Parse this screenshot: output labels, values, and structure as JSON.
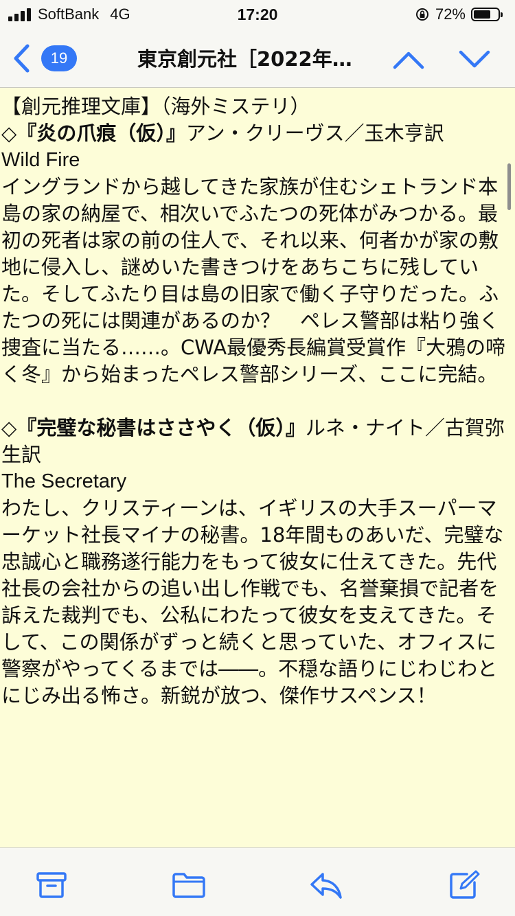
{
  "status_bar": {
    "carrier": "SoftBank",
    "network": "4G",
    "time": "17:20",
    "battery": "72%",
    "battery_level": 0.72
  },
  "nav": {
    "unread_count": "19",
    "title": "東京創元社［2022年…"
  },
  "email": {
    "heading": "【創元推理文庫】（海外ミステリ）",
    "books": [
      {
        "marker": "◇",
        "title": "『炎の爪痕（仮）』",
        "author": "アン・クリーヴス／玉木亨訳",
        "original_title": "Wild Fire",
        "description": "イングランドから越してきた家族が住むシェトランド本島の家の納屋で、相次いでふたつの死体がみつかる。最初の死者は家の前の住人で、それ以来、何者かが家の敷地に侵入し、謎めいた書きつけをあちこちに残していた。そしてふたり目は島の旧家で働く子守りだった。ふたつの死には関連があるのか？　ペレス警部は粘り強く捜査に当たる……。CWA最優秀長編賞受賞作『大鴉の啼く冬』から始まったペレス警部シリーズ、ここに完結。"
      },
      {
        "marker": "◇",
        "title": "『完璧な秘書はささやく（仮）』",
        "author": "ルネ・ナイト／古賀弥生訳",
        "original_title": "The Secretary",
        "description": "わたし、クリスティーンは、イギリスの大手スーパーマーケット社長マイナの秘書。18年間ものあいだ、完璧な忠誠心と職務遂行能力をもって彼女に仕えてきた。先代社長の会社からの追い出し作戦でも、名誉棄損で記者を訴えた裁判でも、公私にわたって彼女を支えてきた。そして、この関係がずっと続くと思っていた、オフィスに警察がやってくるまでは――。不穏な語りにじわじわとにじみ出る怖さ。新鋭が放つ、傑作サスペンス！"
      }
    ]
  },
  "toolbar": {
    "icons": [
      "archive-icon",
      "folder-icon",
      "reply-icon",
      "compose-icon"
    ]
  },
  "colors": {
    "accent": "#3478f6",
    "background": "#fdfdd8",
    "bar": "#f7f7f3"
  }
}
